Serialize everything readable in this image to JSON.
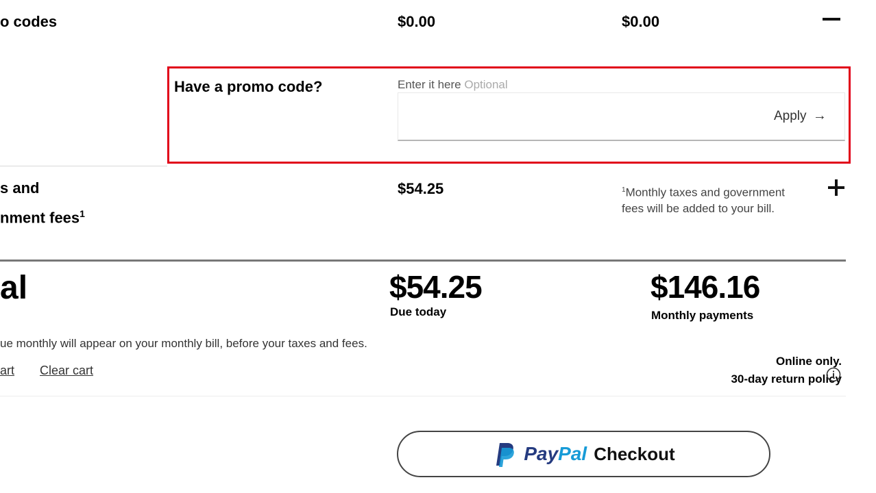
{
  "promo_codes_row": {
    "label": "o codes",
    "due_today": "$0.00",
    "monthly": "$0.00",
    "toggle_icon": "minus-icon"
  },
  "promo": {
    "title": "Have a promo code?",
    "input_label": "Enter it here",
    "input_optional": "Optional",
    "input_value": "",
    "apply_label": "Apply",
    "apply_icon": "arrow-right-icon",
    "highlight_color": "#e10019"
  },
  "taxes_row": {
    "label_line1": "s and",
    "label_line2": "nment fees",
    "label_sup": "1",
    "due_today": "$54.25",
    "footnote_sup": "1",
    "footnote": "Monthly taxes and government fees will be added to your bill.",
    "toggle_icon": "plus-icon"
  },
  "total": {
    "label": "al",
    "due_today_amount": "$54.25",
    "due_today_label": "Due today",
    "monthly_amount": "$146.16",
    "monthly_label": "Monthly payments"
  },
  "note": "ue monthly will appear on your monthly bill, before your taxes and fees.",
  "links": {
    "save_cart": "art",
    "clear_cart": "Clear cart"
  },
  "policy": {
    "line1": "Online only.",
    "line2": "30-day return policy",
    "icon": "info-icon"
  },
  "paypal": {
    "word_pay": "Pay",
    "word_pal": "Pal",
    "label": "Checkout",
    "logo_icon": "paypal-logo-icon",
    "colors": {
      "pay": "#253b80",
      "pal": "#179bd7"
    }
  }
}
